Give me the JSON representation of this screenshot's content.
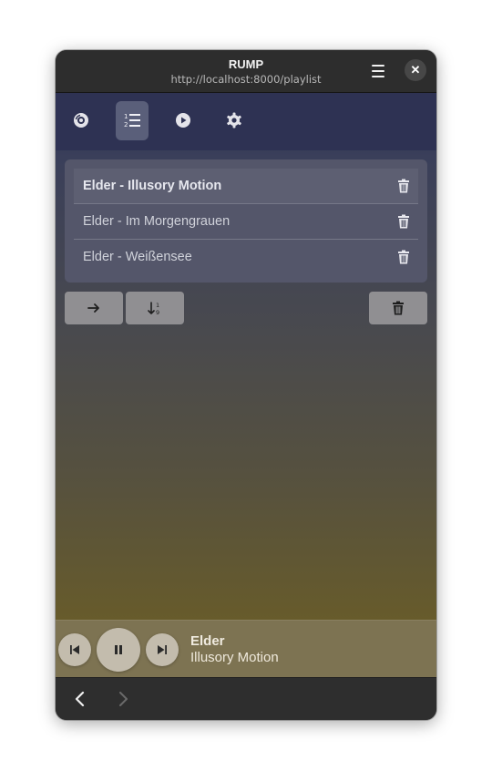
{
  "window": {
    "title": "RUMP",
    "url": "http://localhost:8000/playlist"
  },
  "tabs": [
    {
      "name": "library",
      "icon": "disc-icon",
      "active": false
    },
    {
      "name": "playlist",
      "icon": "numbered-list-icon",
      "active": true
    },
    {
      "name": "now-playing",
      "icon": "play-circle-icon",
      "active": false
    },
    {
      "name": "settings",
      "icon": "gear-icon",
      "active": false
    }
  ],
  "playlist": {
    "items": [
      {
        "label": "Elder - Illusory Motion",
        "current": true
      },
      {
        "label": "Elder - Im Morgengrauen",
        "current": false
      },
      {
        "label": "Elder - Weißensee",
        "current": false
      }
    ]
  },
  "actions": {
    "icons": [
      "arrow-right-icon",
      "sort-icon",
      "trash-icon"
    ]
  },
  "player": {
    "artist": "Elder",
    "title": "Illusory Motion",
    "state": "playing"
  },
  "colors": {
    "accent_tab": "#5a5f7a",
    "player_bg": "#7d7352",
    "gradient_bottom": "#675b2b"
  }
}
